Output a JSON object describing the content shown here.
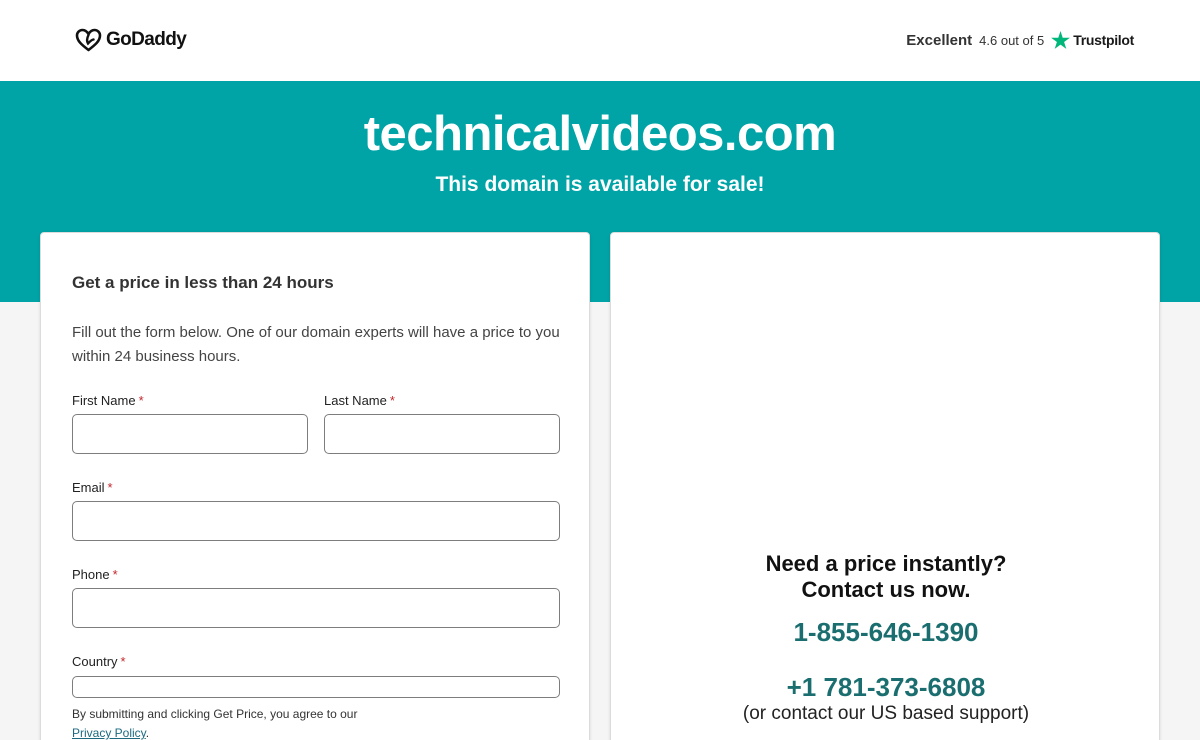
{
  "header": {
    "brand": "GoDaddy",
    "rating_word": "Excellent",
    "rating_score": "4.6 out of 5",
    "review_site": "Trustpilot",
    "colors": {
      "trustpilot_star": "#00b67a"
    }
  },
  "banner": {
    "domain": "technicalvideos.com",
    "subtitle": "This domain is available for sale!",
    "color": "#00a4a6"
  },
  "form": {
    "title": "Get a price in less than 24 hours",
    "description": "Fill out the form below. One of our domain experts will have a price to you within 24 business hours.",
    "required_mark": "*",
    "first_name_label": "First Name",
    "last_name_label": "Last Name",
    "email_label": "Email",
    "phone_label": "Phone",
    "country_label": "Country",
    "legal_text": "By submitting and clicking Get Price, you agree to our",
    "privacy_link": "Privacy Policy",
    "legal_end": "."
  },
  "contact": {
    "heading_line1": "Need a price instantly?",
    "heading_line2": "Contact us now.",
    "phone_primary": "1-855-646-1390",
    "phone_secondary": "+1 781-373-6808",
    "support_note": "(or contact our US based support)",
    "colors": {
      "phone": "#1b6e6f"
    }
  }
}
